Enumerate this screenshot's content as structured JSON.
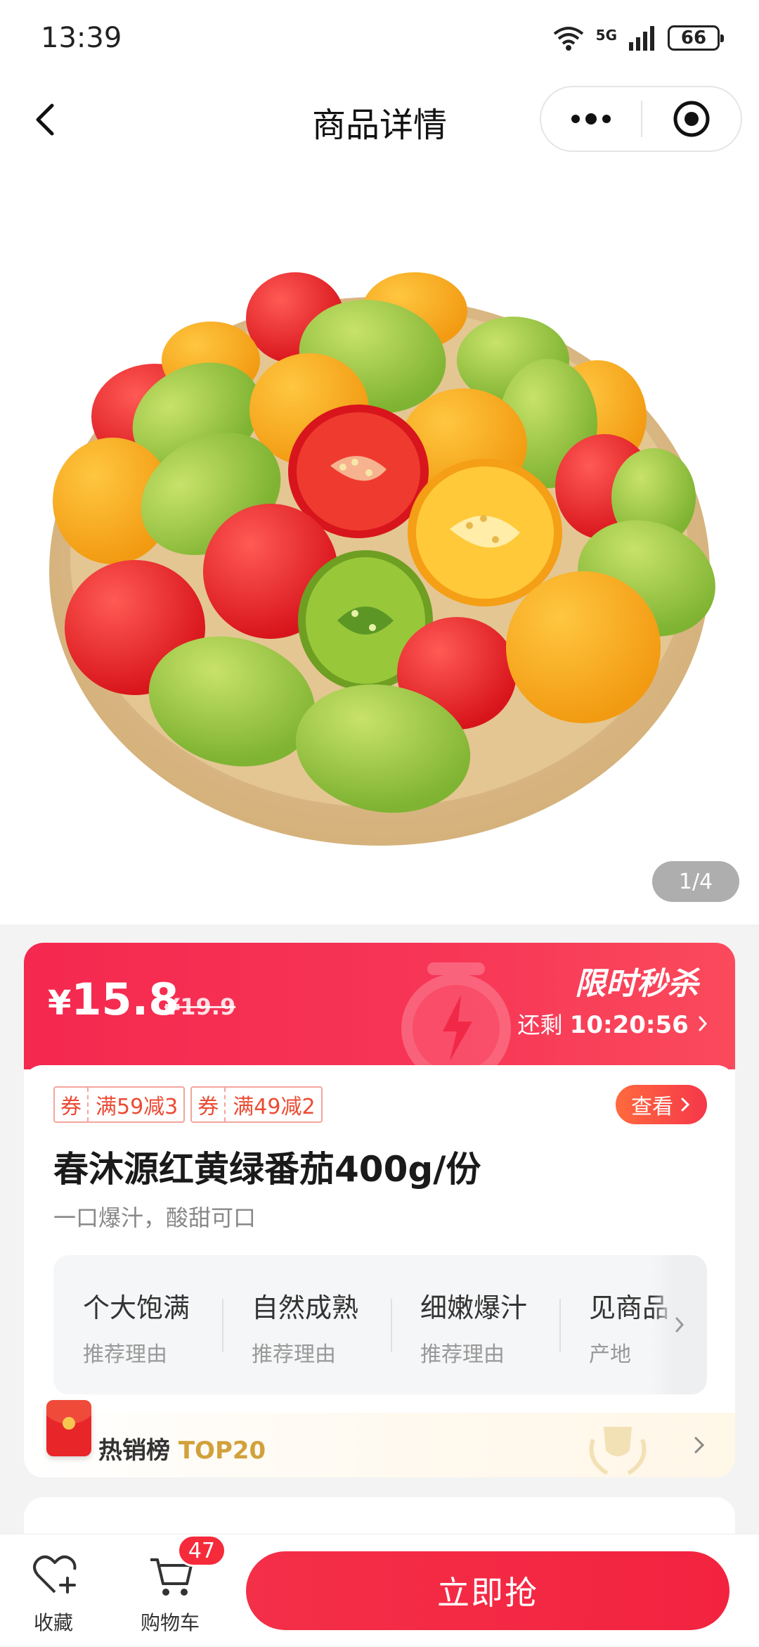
{
  "status_bar": {
    "time": "13:39",
    "network": "5G",
    "battery": "66"
  },
  "nav": {
    "title": "商品详情"
  },
  "gallery": {
    "counter": "1/4"
  },
  "flash_sale": {
    "currency": "¥",
    "price": "15.8",
    "original_price": "¥19.9",
    "label": "限时秒杀",
    "countdown_prefix": "还剩",
    "countdown": "10:20:56",
    "accent_color": "#f5284f"
  },
  "coupons": [
    {
      "tag": "券",
      "text": "满59减3"
    },
    {
      "tag": "券",
      "text": "满49减2"
    }
  ],
  "view_button": "查看",
  "product": {
    "title": "春沐源红黄绿番茄400g/份",
    "subtitle": "一口爆汁，酸甜可口"
  },
  "reasons": [
    {
      "title": "个大饱满",
      "sub": "推荐理由"
    },
    {
      "title": "自然成熟",
      "sub": "推荐理由"
    },
    {
      "title": "细嫩爆汁",
      "sub": "推荐理由"
    },
    {
      "title": "见商品",
      "sub": "产地"
    }
  ],
  "hot_rank": {
    "text": "热销榜",
    "rank": "TOP20"
  },
  "bottom_bar": {
    "favorite_label": "收藏",
    "cart_label": "购物车",
    "cart_count": "47",
    "buy_label": "立即抢",
    "buy_color": "#f42f48"
  }
}
